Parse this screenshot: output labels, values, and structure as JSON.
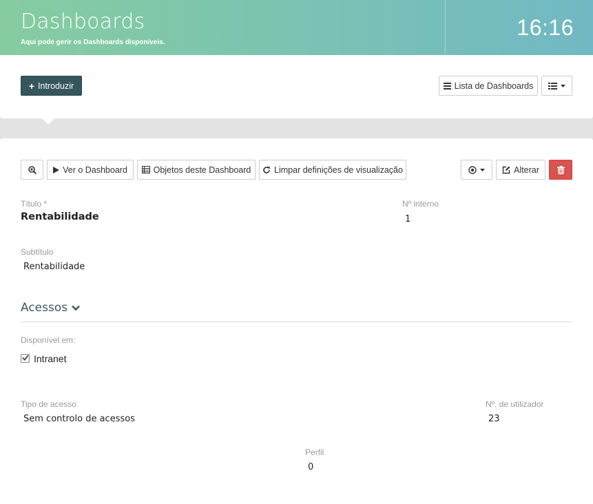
{
  "header": {
    "title": "Dashboards",
    "subtitle": "Aqui pode gerir os Dashboards disponíveis.",
    "clock": "16:16",
    "gradient": [
      "#86cca0",
      "#71b8c4"
    ]
  },
  "toolbar": {
    "add_label": "Introduzir",
    "list_label": "Lista de Dashboards"
  },
  "actions": {
    "view_label": "Ver o Dashboard",
    "objects_label": "Objetos deste Dashboard",
    "clear_label": "Limpar definições de visualização",
    "edit_label": "Alterar"
  },
  "form": {
    "title_label": "Título *",
    "title_value": "Rentabilidade",
    "internal_label": "Nº interno",
    "internal_value": "1",
    "subtitle_label": "Subtítulo",
    "subtitle_value": "Rentabilidade"
  },
  "access": {
    "section_title": "Acessos",
    "available_label": "Disponível em:",
    "intranet_label": "Intranet",
    "intranet_checked": true,
    "type_label": "Tipo de acesso",
    "type_value": "Sem controlo de acessos",
    "users_label": "Nº. de utilizador",
    "users_value": "23",
    "profile_label": "Perfil",
    "profile_value": "0"
  },
  "colors": {
    "primary_dark": "#35565c",
    "danger": "#d9534f",
    "section_text": "#3e5b61"
  }
}
